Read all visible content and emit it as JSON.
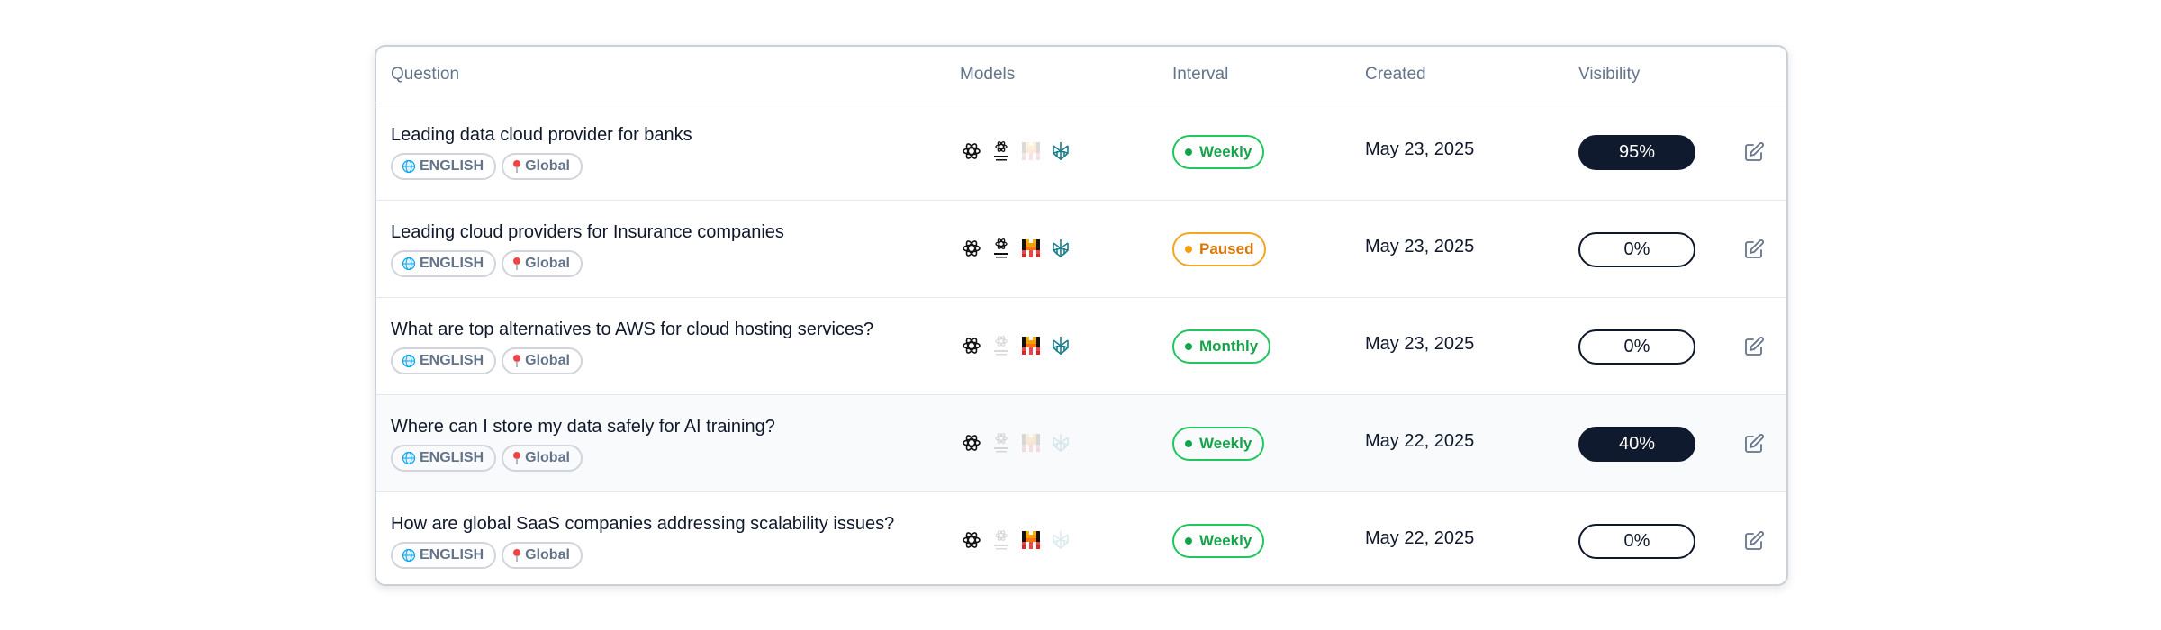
{
  "table": {
    "headers": {
      "question": "Question",
      "models": "Models",
      "interval": "Interval",
      "created": "Created",
      "visibility": "Visibility"
    },
    "rows": [
      {
        "question": "Leading data cloud provider for banks",
        "language": "ENGLISH",
        "location": "Global",
        "models": [
          {
            "icon": "openai-icon",
            "active": true
          },
          {
            "icon": "openai-search-icon",
            "active": true
          },
          {
            "icon": "mistral-icon",
            "active": false
          },
          {
            "icon": "perplexity-icon",
            "active": true
          }
        ],
        "interval": "Weekly",
        "interval_status": "active",
        "created": "May 23, 2025",
        "visibility": "95%",
        "visibility_percent": 95
      },
      {
        "question": "Leading cloud providers for Insurance companies",
        "language": "ENGLISH",
        "location": "Global",
        "models": [
          {
            "icon": "openai-icon",
            "active": true
          },
          {
            "icon": "openai-search-icon",
            "active": true
          },
          {
            "icon": "mistral-icon",
            "active": true
          },
          {
            "icon": "perplexity-icon",
            "active": true
          }
        ],
        "interval": "Paused",
        "interval_status": "paused",
        "created": "May 23, 2025",
        "visibility": "0%",
        "visibility_percent": 0
      },
      {
        "question": "What are top alternatives to AWS for cloud hosting services?",
        "language": "ENGLISH",
        "location": "Global",
        "models": [
          {
            "icon": "openai-icon",
            "active": true
          },
          {
            "icon": "openai-search-icon",
            "active": false
          },
          {
            "icon": "mistral-icon",
            "active": true
          },
          {
            "icon": "perplexity-icon",
            "active": true
          }
        ],
        "interval": "Monthly",
        "interval_status": "active",
        "created": "May 23, 2025",
        "visibility": "0%",
        "visibility_percent": 0
      },
      {
        "question": "Where can I store my data safely for AI training?",
        "language": "ENGLISH",
        "location": "Global",
        "models": [
          {
            "icon": "openai-icon",
            "active": true
          },
          {
            "icon": "openai-search-icon",
            "active": false
          },
          {
            "icon": "mistral-icon",
            "active": false
          },
          {
            "icon": "perplexity-icon",
            "active": false
          }
        ],
        "interval": "Weekly",
        "interval_status": "active",
        "created": "May 22, 2025",
        "visibility": "40%",
        "visibility_percent": 40
      },
      {
        "question": "How are global SaaS companies addressing scalability issues?",
        "language": "ENGLISH",
        "location": "Global",
        "models": [
          {
            "icon": "openai-icon",
            "active": true
          },
          {
            "icon": "openai-search-icon",
            "active": false
          },
          {
            "icon": "mistral-icon",
            "active": true
          },
          {
            "icon": "perplexity-icon",
            "active": false
          }
        ],
        "interval": "Weekly",
        "interval_status": "active",
        "created": "May 22, 2025",
        "visibility": "0%",
        "visibility_percent": 0
      }
    ]
  },
  "colors": {
    "active_green": "#16a34a",
    "paused_amber": "#d97706",
    "visibility_filled": "#101a2e",
    "muted_text": "#64748b"
  }
}
